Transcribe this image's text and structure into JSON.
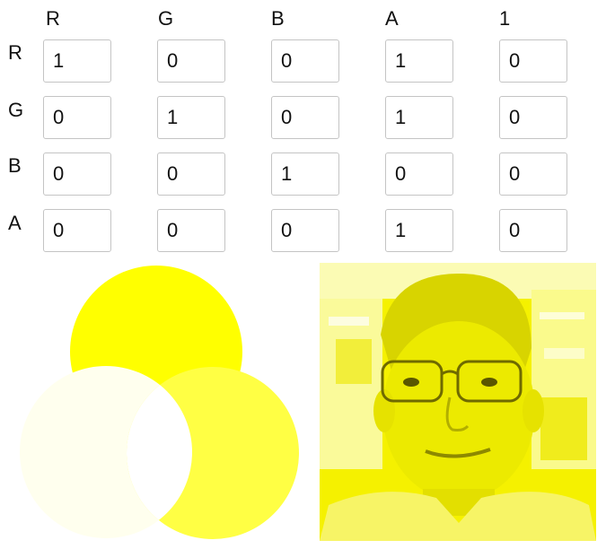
{
  "matrix": {
    "column_headers": [
      "R",
      "G",
      "B",
      "A",
      "1"
    ],
    "row_headers": [
      "R",
      "G",
      "B",
      "A"
    ],
    "values": [
      [
        "1",
        "0",
        "0",
        "1",
        "0"
      ],
      [
        "0",
        "1",
        "0",
        "1",
        "0"
      ],
      [
        "0",
        "0",
        "1",
        "0",
        "0"
      ],
      [
        "0",
        "0",
        "0",
        "1",
        "0"
      ]
    ]
  },
  "preview": {
    "circle_colors": {
      "top": "#ffff00",
      "left": "#ffffee",
      "right": "#ffff44",
      "overlap": "#ffffff"
    },
    "photo_tint": "#ffff00",
    "photo_subject": "person-with-glasses"
  }
}
